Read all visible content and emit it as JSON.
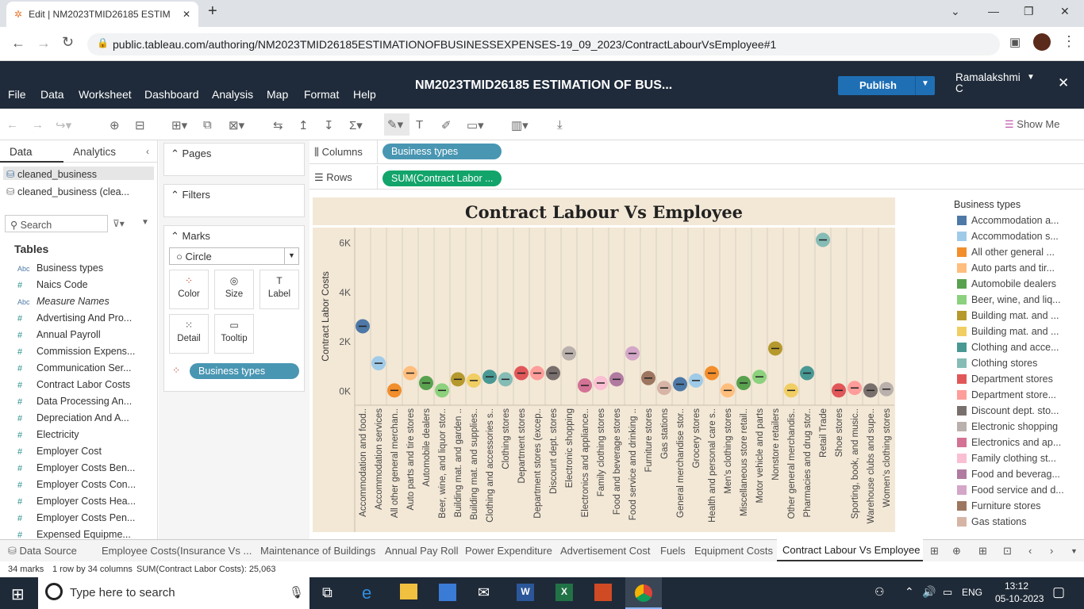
{
  "browser": {
    "tab_title": "Edit | NM2023TMID26185 ESTIM",
    "url": "public.tableau.com/authoring/NM2023TMID26185ESTIMATIONOFBUSINESSEXPENSES-19_09_2023/ContractLabourVsEmployee#1"
  },
  "menu": {
    "items": [
      "File",
      "Data",
      "Worksheet",
      "Dashboard",
      "Analysis",
      "Map",
      "Format",
      "Help"
    ],
    "workbook_title": "NM2023TMID26185 ESTIMATION OF BUS...",
    "publish": "Publish",
    "user": "Ramalakshmi C",
    "show_me": "Show Me"
  },
  "left": {
    "tab_data": "Data",
    "tab_analytics": "Analytics",
    "sources": [
      "cleaned_business",
      "cleaned_business (clea..."
    ],
    "search": "Search",
    "tables_label": "Tables",
    "fields": [
      {
        "icon": "Abc",
        "name": "Business types"
      },
      {
        "icon": "#",
        "name": "Naics Code"
      },
      {
        "icon": "Abc",
        "name": "Measure Names"
      },
      {
        "icon": "#",
        "name": "Advertising And Pro..."
      },
      {
        "icon": "#",
        "name": "Annual Payroll"
      },
      {
        "icon": "#",
        "name": "Commission Expens..."
      },
      {
        "icon": "#",
        "name": "Communication Ser..."
      },
      {
        "icon": "#",
        "name": "Contract Labor Costs"
      },
      {
        "icon": "#",
        "name": "Data Processing An..."
      },
      {
        "icon": "#",
        "name": "Depreciation And A..."
      },
      {
        "icon": "#",
        "name": "Electricity"
      },
      {
        "icon": "#",
        "name": "Employer Cost"
      },
      {
        "icon": "#",
        "name": "Employer Costs Ben..."
      },
      {
        "icon": "#",
        "name": "Employer Costs Con..."
      },
      {
        "icon": "#",
        "name": "Employer Costs Hea..."
      },
      {
        "icon": "#",
        "name": "Employer Costs Pen..."
      },
      {
        "icon": "#",
        "name": "Expensed Equipme..."
      }
    ]
  },
  "shelves": {
    "pages": "Pages",
    "filters": "Filters",
    "marks": "Marks",
    "mark_type": "Circle",
    "color": "Color",
    "size": "Size",
    "label": "Label",
    "detail": "Detail",
    "tooltip": "Tooltip",
    "color_field": "Business types",
    "columns_label": "Columns",
    "rows_label": "Rows",
    "columns_pill": "Business types",
    "rows_pill": "SUM(Contract Labor ..."
  },
  "legend": {
    "title": "Business types",
    "items": [
      {
        "label": "Accommodation a...",
        "color": "#4e79a7"
      },
      {
        "label": "Accommodation s...",
        "color": "#a0cbe8"
      },
      {
        "label": "All other general ...",
        "color": "#f28e2b"
      },
      {
        "label": "Auto parts and tir...",
        "color": "#ffbe7d"
      },
      {
        "label": "Automobile dealers",
        "color": "#59a14f"
      },
      {
        "label": "Beer, wine, and liq...",
        "color": "#8cd17d"
      },
      {
        "label": "Building mat. and ...",
        "color": "#b6992d"
      },
      {
        "label": "Building mat. and ...",
        "color": "#f1ce63"
      },
      {
        "label": "Clothing and acce...",
        "color": "#499894"
      },
      {
        "label": "Clothing stores",
        "color": "#86bcb6"
      },
      {
        "label": "Department stores",
        "color": "#e15759"
      },
      {
        "label": "Department store...",
        "color": "#ff9d9a"
      },
      {
        "label": "Discount dept. sto...",
        "color": "#79706e"
      },
      {
        "label": "Electronic shopping",
        "color": "#bab0ac"
      },
      {
        "label": "Electronics and ap...",
        "color": "#d37295"
      },
      {
        "label": "Family clothing st...",
        "color": "#fabfd2"
      },
      {
        "label": "Food and beverag...",
        "color": "#b07aa1"
      },
      {
        "label": "Food service and d...",
        "color": "#d4a6c8"
      },
      {
        "label": "Furniture stores",
        "color": "#9d7660"
      },
      {
        "label": "Gas stations",
        "color": "#d7b5a6"
      }
    ]
  },
  "chart_data": {
    "type": "scatter",
    "title": "Contract Labour Vs Employee",
    "ylabel": "Contract Labor Costs",
    "ylim": [
      -600,
      6600
    ],
    "yticks": [
      "0K",
      "2K",
      "4K",
      "6K"
    ],
    "categories": [
      "Accommodation and food..",
      "Accommodation services",
      "All other general merchan..",
      "Auto parts and tire stores",
      "Automobile dealers",
      "Beer, wine, and liquor stor..",
      "Building mat. and garden ..",
      "Building mat. and supplies..",
      "Clothing and accessories s..",
      "Clothing stores",
      "Department stores",
      "Department stores (excep..",
      "Discount dept. stores",
      "Electronic shopping",
      "Electronics and appliance..",
      "Family clothing stores",
      "Food and beverage stores",
      "Food service and drinking ..",
      "Furniture stores",
      "Gas stations",
      "General merchandise stor..",
      "Grocery stores",
      "Health and personal care s..",
      "Men's clothing stores",
      "Miscellaneous store retail..",
      "Motor vehicle and parts",
      "Nonstore retailers",
      "Other general merchandis..",
      "Pharmacies and drug stor..",
      "Retail Trade",
      "Shoe stores",
      "Sporting, book, and music..",
      "Warehouse clubs and supe..",
      "Women's clothing stores"
    ],
    "values": [
      2600,
      1100,
      0,
      700,
      300,
      0,
      450,
      400,
      550,
      450,
      700,
      700,
      700,
      1500,
      200,
      300,
      450,
      1500,
      500,
      100,
      250,
      400,
      700,
      0,
      300,
      550,
      1700,
      0,
      700,
      6100,
      0,
      100,
      0,
      50
    ],
    "colors": [
      "#4e79a7",
      "#a0cbe8",
      "#f28e2b",
      "#ffbe7d",
      "#59a14f",
      "#8cd17d",
      "#b6992d",
      "#f1ce63",
      "#499894",
      "#86bcb6",
      "#e15759",
      "#ff9d9a",
      "#79706e",
      "#bab0ac",
      "#d37295",
      "#fabfd2",
      "#b07aa1",
      "#d4a6c8",
      "#9d7660",
      "#d7b5a6",
      "#4e79a7",
      "#a0cbe8",
      "#f28e2b",
      "#ffbe7d",
      "#59a14f",
      "#8cd17d",
      "#b6992d",
      "#f1ce63",
      "#499894",
      "#86bcb6",
      "#e15759",
      "#ff9d9a",
      "#79706e",
      "#bab0ac"
    ]
  },
  "sheets": [
    "Data Source",
    "Employee Costs(Insurance Vs ...",
    "Maintenance of Buildings",
    "Annual Pay Roll",
    "Power Expenditure",
    "Advertisement Cost",
    "Fuels",
    "Equipment Costs",
    "Contract Labour Vs Employee"
  ],
  "status": {
    "marks": "34 marks",
    "dims": "1 row by 34 columns",
    "sum": "SUM(Contract Labor Costs): 25,063"
  },
  "taskbar": {
    "search": "Type here to search",
    "lang": "ENG",
    "time": "13:12",
    "date": "05-10-2023"
  }
}
